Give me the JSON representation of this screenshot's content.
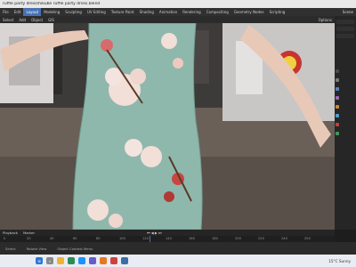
{
  "titlebar": {
    "title": "ruffle party dress\\hikube ruffle party dress.blend"
  },
  "workspace_tabs": [
    {
      "label": "File"
    },
    {
      "label": "Edit"
    },
    {
      "label": "Layout",
      "active": true
    },
    {
      "label": "Modeling"
    },
    {
      "label": "Sculpting"
    },
    {
      "label": "UV Editing"
    },
    {
      "label": "Texture Paint"
    },
    {
      "label": "Shading"
    },
    {
      "label": "Animation"
    },
    {
      "label": "Rendering"
    },
    {
      "label": "Compositing"
    },
    {
      "label": "Geometry Nodes"
    },
    {
      "label": "Scripting"
    }
  ],
  "header_right": {
    "scene_label": "Scene"
  },
  "viewport_header": {
    "select": "Select",
    "add": "Add",
    "object": "Object",
    "gis": "GIS",
    "options": "Options"
  },
  "timeline": {
    "mode": "Playback",
    "marker_label": "Marker",
    "ticks": [
      "0",
      "20",
      "40",
      "60",
      "80",
      "100",
      "120",
      "140",
      "160",
      "180",
      "200",
      "220",
      "240",
      "250"
    ]
  },
  "statusbar": {
    "left": "Select",
    "mid": "Rotate View",
    "right": "Object Context Menu"
  },
  "taskbar": {
    "weather": "15°C Sunny",
    "search": "Search"
  },
  "colors": {
    "accent": "#4772b3",
    "dress": "#8fb8ad",
    "flower": "#f2dfd8"
  }
}
